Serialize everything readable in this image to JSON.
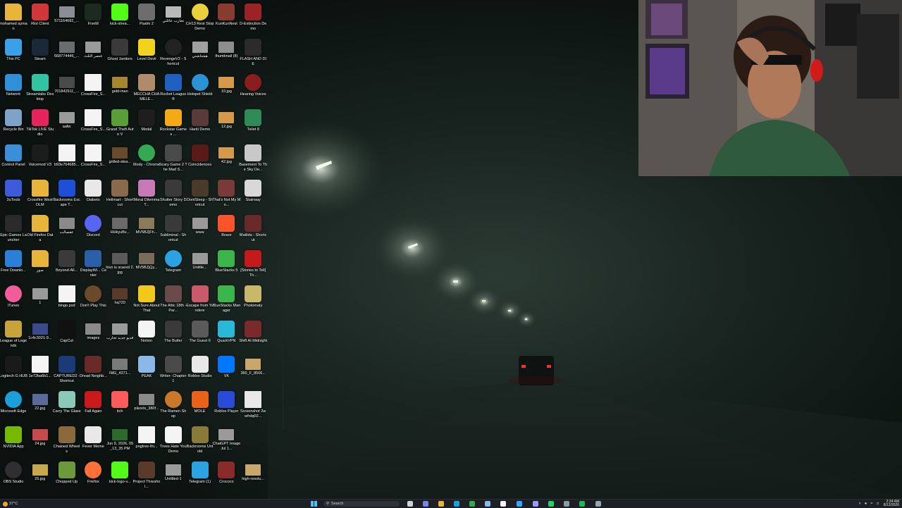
{
  "desktop": {
    "icons": [
      {
        "label": "mohamed ayman",
        "color": "#e8b53a",
        "shape": "folder"
      },
      {
        "label": "Riot Client",
        "color": "#d13639",
        "shape": "app"
      },
      {
        "label": "571164682_...",
        "color": "#8a8d91",
        "shape": "image"
      },
      {
        "label": "FiveM",
        "color": "#1d2a22",
        "shape": "app"
      },
      {
        "label": "kick-strea...",
        "color": "#53fc18",
        "shape": "app"
      },
      {
        "label": "Psalm 2",
        "color": "#6d6d6d",
        "shape": "app"
      },
      {
        "label": "تجارب عائلتي",
        "color": "#b9b9b9",
        "shape": "image"
      },
      {
        "label": "CH13 Rest Stop Demo",
        "color": "#e8d13a",
        "shape": "round"
      },
      {
        "label": "KunKunNest",
        "color": "#8a3b2f",
        "shape": "app"
      },
      {
        "label": "D-Extinction Demo",
        "color": "#9b2226",
        "shape": "app"
      },
      {
        "label": "This PC",
        "color": "#3aa0e8",
        "shape": "app"
      },
      {
        "label": "Steam",
        "color": "#1b2838",
        "shape": "app"
      },
      {
        "label": "668774446_...",
        "color": "#6a6d70",
        "shape": "image"
      },
      {
        "label": "عنصر الثلث",
        "color": "#9a9a9a",
        "shape": "image"
      },
      {
        "label": "Ghost Janitors",
        "color": "#3a3a3a",
        "shape": "app"
      },
      {
        "label": "Level Devil",
        "color": "#f2d21b",
        "shape": "app"
      },
      {
        "label": "RevengeV2 - Shortcut",
        "color": "#222222",
        "shape": "round"
      },
      {
        "label": "هشتاشتي",
        "color": "#a0a0a0",
        "shape": "image"
      },
      {
        "label": "thumbnail (8)",
        "color": "#8d8d8d",
        "shape": "image"
      },
      {
        "label": "FLASH AND DIE",
        "color": "#2b2b2b",
        "shape": "app"
      },
      {
        "label": "Network",
        "color": "#2f8fd8",
        "shape": "app"
      },
      {
        "label": "Streamlabs Desktop",
        "color": "#31c3a2",
        "shape": "app"
      },
      {
        "label": "701842911_...",
        "color": "#4a4a4a",
        "shape": "image"
      },
      {
        "label": "CrossFire_S...",
        "color": "#f4f4f4",
        "shape": "file"
      },
      {
        "label": "gold-man",
        "color": "#a8862f",
        "shape": "image"
      },
      {
        "label": "MECCHA CHAMELE...",
        "color": "#b08a6a",
        "shape": "app"
      },
      {
        "label": "Rocket League®",
        "color": "#1f5fbf",
        "shape": "app"
      },
      {
        "label": "Hotspot Shield",
        "color": "#2a93d5",
        "shape": "round"
      },
      {
        "label": "10.jpg",
        "color": "#d49a4a",
        "shape": "image"
      },
      {
        "label": "Hearing Voices",
        "color": "#8a1e1e",
        "shape": "round"
      },
      {
        "label": "Recycle Bin",
        "color": "#7fa3c8",
        "shape": "app"
      },
      {
        "label": "TikTok LIVE Studio",
        "color": "#e5245e",
        "shape": "app"
      },
      {
        "label": "aafw",
        "color": "#9a9a9a",
        "shape": "image"
      },
      {
        "label": "CrossFire_S...",
        "color": "#f4f4f4",
        "shape": "file"
      },
      {
        "label": "Grand Theft Auto V",
        "color": "#5a9e3a",
        "shape": "app"
      },
      {
        "label": "Medal",
        "color": "#1e1e1e",
        "shape": "app"
      },
      {
        "label": "Rockstar Games ...",
        "color": "#f6a917",
        "shape": "app"
      },
      {
        "label": "Hariti Demo",
        "color": "#5a3a3a",
        "shape": "app"
      },
      {
        "label": "12.jpg",
        "color": "#d49a4a",
        "shape": "image"
      },
      {
        "label": "Toilet 8",
        "color": "#2e8b57",
        "shape": "app"
      },
      {
        "label": "Control Panel",
        "color": "#3a8fd8",
        "shape": "app"
      },
      {
        "label": "Voicemod V3",
        "color": "#1c1c1c",
        "shape": "app"
      },
      {
        "label": "b93e764685...",
        "color": "#f4f4f4",
        "shape": "file"
      },
      {
        "label": "CrossFire_S...",
        "color": "#f4f4f4",
        "shape": "file"
      },
      {
        "label": "grilled-stea...",
        "color": "#6a4a2a",
        "shape": "image"
      },
      {
        "label": "Mody - Chrome",
        "color": "#34a853",
        "shape": "round"
      },
      {
        "label": "Scary Game 2 The Mad S...",
        "color": "#4a4a4a",
        "shape": "app"
      },
      {
        "label": "Coincidences",
        "color": "#5a1a1a",
        "shape": "app"
      },
      {
        "label": "42.jpg",
        "color": "#d49a4a",
        "shape": "image"
      },
      {
        "label": "Basement To The Sky De...",
        "color": "#c8c8c8",
        "shape": "app"
      },
      {
        "label": "3uTools",
        "color": "#3b5bdb",
        "shape": "app"
      },
      {
        "label": "Crossfire West DLM",
        "color": "#e8b53a",
        "shape": "folder"
      },
      {
        "label": "Backrooms Escape T...",
        "color": "#1f4fd8",
        "shape": "app"
      },
      {
        "label": "Diabeto",
        "color": "#e8e8e8",
        "shape": "app"
      },
      {
        "label": "Hellmart - Shortcut",
        "color": "#8a6a4a",
        "shape": "app"
      },
      {
        "label": "Moral Dilemma T...",
        "color": "#c87ab8",
        "shape": "app"
      },
      {
        "label": "Shutter Story Demo",
        "color": "#3a3a3a",
        "shape": "app"
      },
      {
        "label": "DontSleep - Shortcut",
        "color": "#4a3a2a",
        "shape": "app"
      },
      {
        "label": "That's Not My Mo...",
        "color": "#7a3a3a",
        "shape": "app"
      },
      {
        "label": "Stairway",
        "color": "#d8d8d8",
        "shape": "app"
      },
      {
        "label": "Epic Games Launcher",
        "color": "#2a2a2a",
        "shape": "app"
      },
      {
        "label": "Old Firefox Data",
        "color": "#e8b53a",
        "shape": "folder"
      },
      {
        "label": "عقصالت",
        "color": "#8a8a8a",
        "shape": "image"
      },
      {
        "label": "Discord",
        "color": "#5865f2",
        "shape": "round"
      },
      {
        "label": "HHkyuBv...",
        "color": "#6a6a6a",
        "shape": "image"
      },
      {
        "label": "MV5BZjFh...",
        "color": "#8a7a5a",
        "shape": "image"
      },
      {
        "label": "Subliminal - Shortcut",
        "color": "#3a3a3a",
        "shape": "app"
      },
      {
        "label": "www",
        "color": "#9a9a9a",
        "shape": "image"
      },
      {
        "label": "Brave",
        "color": "#fb542b",
        "shape": "app"
      },
      {
        "label": "Matilda - Shortcut",
        "color": "#6a2a2a",
        "shape": "app"
      },
      {
        "label": "Free Downlo...",
        "color": "#2a7fd8",
        "shape": "app"
      },
      {
        "label": "صور",
        "color": "#e8b53a",
        "shape": "folder"
      },
      {
        "label": "Beyond-All...",
        "color": "#3a3a3a",
        "shape": "app"
      },
      {
        "label": "DisplayWi... Center",
        "color": "#2a5fa8",
        "shape": "app"
      },
      {
        "label": "hivo is scared 2.jpg",
        "color": "#5a5a5a",
        "shape": "image"
      },
      {
        "label": "MV5BZjQy...",
        "color": "#7a6a5a",
        "shape": "image"
      },
      {
        "label": "Telegram",
        "color": "#2aa3e0",
        "shape": "round"
      },
      {
        "label": "Untitle...",
        "color": "#9a9a9a",
        "shape": "image"
      },
      {
        "label": "BlueStacks 5",
        "color": "#3ab54a",
        "shape": "app"
      },
      {
        "label": "[Stories to Tell] Th...",
        "color": "#c41a1a",
        "shape": "app"
      },
      {
        "label": "iTunes",
        "color": "#f25c9a",
        "shape": "round"
      },
      {
        "label": "1",
        "color": "#9a9a9a",
        "shape": "image"
      },
      {
        "label": "bingo.psd",
        "color": "#f4f4f4",
        "shape": "file"
      },
      {
        "label": "Don't Play This",
        "color": "#6a4a2a",
        "shape": "round"
      },
      {
        "label": "hq720",
        "color": "#5a3a2a",
        "shape": "image"
      },
      {
        "label": "Not Sure About That",
        "color": "#f2c81b",
        "shape": "app"
      },
      {
        "label": "The Attic 18th - Par...",
        "color": "#6a4a4a",
        "shape": "app"
      },
      {
        "label": "Escape from Yandere",
        "color": "#c85a6a",
        "shape": "app"
      },
      {
        "label": "BlueStacks Manager",
        "color": "#3ab54a",
        "shape": "app"
      },
      {
        "label": "Photomaty",
        "color": "#c8b86a",
        "shape": "app"
      },
      {
        "label": "League of Legends",
        "color": "#c8a23a",
        "shape": "app"
      },
      {
        "label": "1c4c3021-9...",
        "color": "#3a4a8a",
        "shape": "image"
      },
      {
        "label": "CapCut",
        "color": "#111111",
        "shape": "app"
      },
      {
        "label": "images",
        "color": "#8a8a8a",
        "shape": "image"
      },
      {
        "label": "فديو جديد تجارب",
        "color": "#9a9a9a",
        "shape": "image"
      },
      {
        "label": "Notion",
        "color": "#f4f4f4",
        "shape": "app"
      },
      {
        "label": "The Butler",
        "color": "#3a3a3a",
        "shape": "app"
      },
      {
        "label": "The Guest II",
        "color": "#5a5a5a",
        "shape": "app"
      },
      {
        "label": "QuarkVPN",
        "color": "#2ab8d8",
        "shape": "app"
      },
      {
        "label": "Shift At Midnight",
        "color": "#7a2a2a",
        "shape": "app"
      },
      {
        "label": "Logitech G HUB",
        "color": "#1a1a1a",
        "shape": "app"
      },
      {
        "label": "1e72ba6b1...",
        "color": "#f4f4f4",
        "shape": "file"
      },
      {
        "label": "CAPTURED2 - Shortcut",
        "color": "#1a3a7a",
        "shape": "app"
      },
      {
        "label": "Dread Neighb...",
        "color": "#6a2a2a",
        "shape": "app"
      },
      {
        "label": "IMG_4371...",
        "color": "#7a7a7a",
        "shape": "image"
      },
      {
        "label": "PEAK",
        "color": "#8ab8e8",
        "shape": "app"
      },
      {
        "label": "Writer- Chapter 1",
        "color": "#4a4a4a",
        "shape": "app"
      },
      {
        "label": "Roblox Studio",
        "color": "#e8e8e8",
        "shape": "app"
      },
      {
        "label": "VK",
        "color": "#0077ff",
        "shape": "app"
      },
      {
        "label": "360_F_8506...",
        "color": "#c8a86a",
        "shape": "image"
      },
      {
        "label": "Microsoft Edge",
        "color": "#1a9fd8",
        "shape": "round"
      },
      {
        "label": "22.jpg",
        "color": "#5a6a9a",
        "shape": "image"
      },
      {
        "label": "Carry The Glass",
        "color": "#8ac8b8",
        "shape": "app"
      },
      {
        "label": "Fall Again",
        "color": "#c81a1a",
        "shape": "app"
      },
      {
        "label": "itch",
        "color": "#fa5c5c",
        "shape": "app"
      },
      {
        "label": "pikzels_380f...",
        "color": "#8a8a8a",
        "shape": "image"
      },
      {
        "label": "The Ramen Shop",
        "color": "#c87a2a",
        "shape": "round"
      },
      {
        "label": "MOLE",
        "color": "#e8621a",
        "shape": "app"
      },
      {
        "label": "Roblox Player",
        "color": "#2a4ad8",
        "shape": "app"
      },
      {
        "label": "Screenshot 2wwfrdq02...",
        "color": "#e8e8e8",
        "shape": "file"
      },
      {
        "label": "NVIDIA App",
        "color": "#76b900",
        "shape": "app"
      },
      {
        "label": "24.jpg",
        "color": "#c84a4a",
        "shape": "image"
      },
      {
        "label": "Chained Wheels",
        "color": "#8a6a3a",
        "shape": "app"
      },
      {
        "label": "Fever Meme",
        "color": "#e8e8e8",
        "shape": "app"
      },
      {
        "label": "Jun 9, 2026, 05_13_35 PM",
        "color": "#2a6a2a",
        "shape": "image"
      },
      {
        "label": "pngtree-thi...",
        "color": "#f4f4f4",
        "shape": "file"
      },
      {
        "label": "Trees Hate You Demo",
        "color": "#f4f4f4",
        "shape": "app"
      },
      {
        "label": "Backrooms Untold",
        "color": "#8a7a3a",
        "shape": "app"
      },
      {
        "label": "ChatGPT Image Jul 1...",
        "color": "#9a9a9a",
        "shape": "image"
      },
      {
        "label": "",
        "color": "",
        "shape": "none"
      },
      {
        "label": "OBS Studio",
        "color": "#302e31",
        "shape": "round"
      },
      {
        "label": "25.jpg",
        "color": "#c8a84a",
        "shape": "image"
      },
      {
        "label": "Chopped Up",
        "color": "#6a9a3a",
        "shape": "app"
      },
      {
        "label": "Firefox",
        "color": "#ff7139",
        "shape": "round"
      },
      {
        "label": "kick-logo-v...",
        "color": "#53fc18",
        "shape": "app"
      },
      {
        "label": "Project Threshol...",
        "color": "#5a3a2a",
        "shape": "app"
      },
      {
        "label": "Untitled-1",
        "color": "#9a9a9a",
        "shape": "image"
      },
      {
        "label": "Telegram (1)",
        "color": "#2aa3e0",
        "shape": "app"
      },
      {
        "label": "Crococo",
        "color": "#8a2a2a",
        "shape": "app"
      },
      {
        "label": "high-resolu...",
        "color": "#c8a86a",
        "shape": "image"
      }
    ]
  },
  "taskbar": {
    "weather_temp": "37°C",
    "search_placeholder": "Search",
    "time": "2:34 AM",
    "date": "8/12/2026",
    "apps": [
      {
        "name": "task-view",
        "color": "#cfd3d8"
      },
      {
        "name": "teams",
        "color": "#7b83eb"
      },
      {
        "name": "file-explorer",
        "color": "#e8b53a"
      },
      {
        "name": "edge",
        "color": "#1a9fd8"
      },
      {
        "name": "chrome",
        "color": "#34a853"
      },
      {
        "name": "photos",
        "color": "#8ab8e8"
      },
      {
        "name": "notion",
        "color": "#f4f4f4"
      },
      {
        "name": "photoshop",
        "color": "#31a8ff"
      },
      {
        "name": "premiere",
        "color": "#9999ff"
      },
      {
        "name": "whatsapp",
        "color": "#25d366"
      },
      {
        "name": "steam-tb",
        "color": "#8a9aa8"
      },
      {
        "name": "spotify",
        "color": "#1db954"
      },
      {
        "name": "settings",
        "color": "#9aa4ae"
      }
    ]
  }
}
